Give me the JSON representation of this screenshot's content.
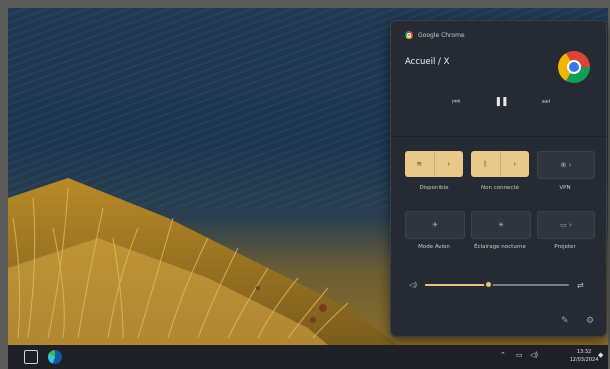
{
  "media": {
    "app_name": "Google Chrome",
    "title": "Accueil / X",
    "prev_icon": "⏮",
    "play_icon": "❚❚",
    "next_icon": "⏭"
  },
  "quick_settings": {
    "tiles": [
      {
        "name": "wifi",
        "label": "Disponible",
        "icon": "wifi-icon",
        "active": true
      },
      {
        "name": "bluetooth",
        "label": "Non connecté",
        "icon": "bluetooth-icon",
        "active": true
      },
      {
        "name": "vpn",
        "label": "VPN",
        "icon": "vpn-icon",
        "active": false
      },
      {
        "name": "airplane",
        "label": "Mode Avion",
        "icon": "airplane-icon",
        "active": false
      },
      {
        "name": "nightlight",
        "label": "Éclairage nocturne",
        "icon": "brightness-icon",
        "active": false
      },
      {
        "name": "cast",
        "label": "Projeter",
        "icon": "cast-icon",
        "active": false
      }
    ],
    "volume_level": 0.44
  },
  "taskbar": {
    "time": "13:32",
    "date": "12/03/2024"
  },
  "colors": {
    "accent": "#e8c98a",
    "panel_bg": "#262b33",
    "taskbar_bg": "#1f2026"
  }
}
